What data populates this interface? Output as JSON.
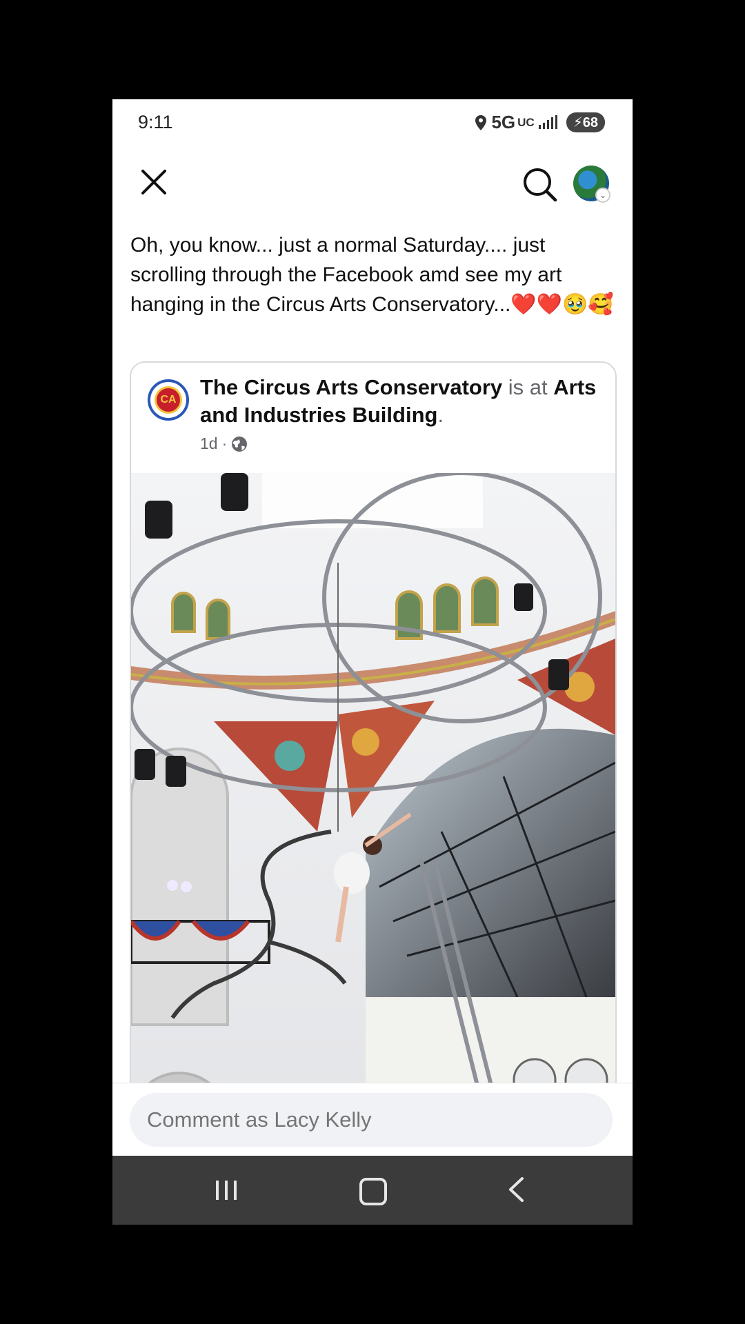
{
  "status_bar": {
    "time": "9:11",
    "network": "5G",
    "network_sub": "UC",
    "battery": "68"
  },
  "post": {
    "text": "Oh, you know... just a normal Saturday.... just scrolling through the Facebook amd see my art hanging in the Circus Arts Conservatory...❤️❤️🥹🥰"
  },
  "shared_post": {
    "page_name": "The Circus Arts Conservatory",
    "connector": " is at ",
    "location": "Arts and Industries Building",
    "period": ".",
    "time": "1d",
    "separator": " · ",
    "privacy_icon": "globe-icon"
  },
  "comment": {
    "placeholder": "Comment as Lacy Kelly"
  },
  "icons": {
    "close": "close-icon",
    "search": "search-icon",
    "nav_recent": "recent-apps-icon",
    "nav_home": "home-icon",
    "nav_back": "back-icon"
  },
  "colors": {
    "accent_blue": "#2d6fc9",
    "muted_text": "#65676b",
    "nav_bg": "#3b3b3b"
  }
}
